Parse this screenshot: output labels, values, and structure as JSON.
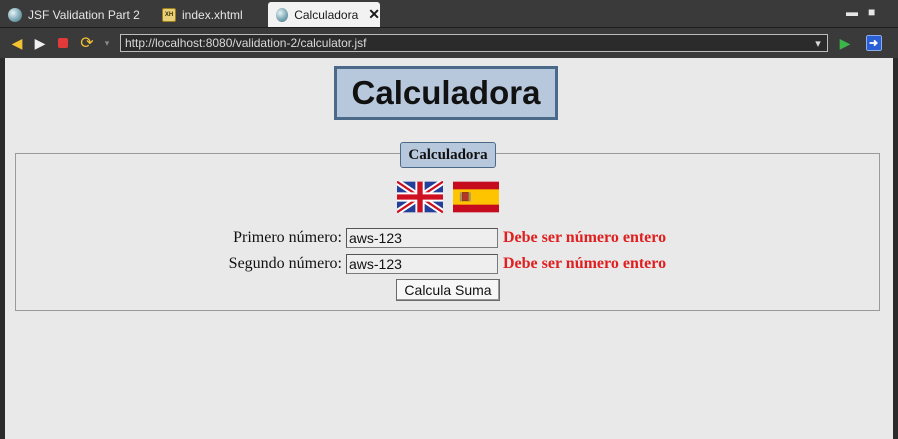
{
  "tabs": [
    {
      "label": "JSF Validation Part 2",
      "icon": "globe-icon"
    },
    {
      "label": "index.xhtml",
      "icon": "xhtml-file-icon"
    },
    {
      "label": "Calculadora",
      "icon": "globe-icon",
      "active": true
    }
  ],
  "browser": {
    "url": "http://localhost:8080/validation-2/calculator.jsf"
  },
  "page": {
    "heading": "Calculadora",
    "panel_legend": "Calculadora",
    "flags": [
      "uk-flag-icon",
      "spain-flag-icon"
    ],
    "rows": [
      {
        "label": "Primero número:",
        "value": "aws-123",
        "error": "Debe ser número entero"
      },
      {
        "label": "Segundo número:",
        "value": "aws-123",
        "error": "Debe ser número entero"
      }
    ],
    "submit_label": "Calcula Suma"
  },
  "colors": {
    "error": "#e02020",
    "heading_bg": "#b7c8dc",
    "heading_border": "#4b6a8a",
    "page_bg": "#e9e9e9",
    "chrome_bg": "#3a3a3a"
  }
}
